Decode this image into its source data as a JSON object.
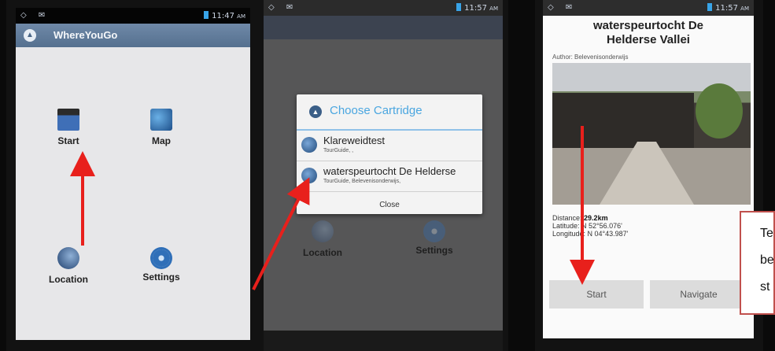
{
  "phone1": {
    "status": {
      "left_icons": "◇ ✉",
      "time": "11:47",
      "ampm": "AM"
    },
    "app_title": "WhereYouGo",
    "tiles": {
      "start": "Start",
      "map": "Map",
      "location": "Location",
      "settings": "Settings"
    }
  },
  "phone2": {
    "status": {
      "time": "11:57",
      "ampm": "AM"
    },
    "dialog": {
      "title": "Choose Cartridge",
      "items": [
        {
          "title": "Klareweidtest",
          "subtitle": "TourGuide, ,"
        },
        {
          "title": "waterspeurtocht De Helderse",
          "subtitle": "TourGuide, Belevenisonderwijs,"
        }
      ],
      "close_label": "Close"
    },
    "background_tiles": {
      "location": "Location",
      "settings": "Settings"
    }
  },
  "phone3": {
    "status": {
      "time": "11:57",
      "ampm": "AM"
    },
    "title_line1": "waterspeurtocht De",
    "title_line2": "Helderse Vallei",
    "author": "Author: Belevenisonderwijs",
    "distance_label": "Distance:",
    "distance_value": "29.2km",
    "latitude": "Latitude: N 52°56.076'",
    "longitude": "Longitude: N 04°43.987'",
    "start_button": "Start",
    "navigate_button": "Navigate"
  },
  "callout": {
    "line1": "Te",
    "line2": "be",
    "line3": "st"
  },
  "colors": {
    "arrow": "#e8201c",
    "accent": "#4aa6e0",
    "callout_border": "#c0504d"
  }
}
